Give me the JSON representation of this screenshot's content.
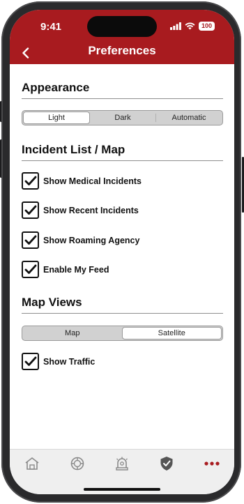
{
  "status": {
    "time": "9:41",
    "battery": "100"
  },
  "header": {
    "title": "Preferences"
  },
  "appearance": {
    "title": "Appearance",
    "options": [
      "Light",
      "Dark",
      "Automatic"
    ],
    "selected": "Light"
  },
  "incident": {
    "title": "Incident List / Map",
    "items": [
      {
        "label": "Show Medical Incidents",
        "checked": true
      },
      {
        "label": "Show Recent Incidents",
        "checked": true
      },
      {
        "label": "Show Roaming Agency",
        "checked": true
      },
      {
        "label": "Enable My Feed",
        "checked": true
      }
    ]
  },
  "mapviews": {
    "title": "Map Views",
    "options": [
      "Map",
      "Satellite"
    ],
    "selected": "Satellite",
    "items": [
      {
        "label": "Show Traffic",
        "checked": true
      }
    ]
  },
  "tabs": [
    {
      "icon": "house-icon"
    },
    {
      "icon": "fire-badge-icon"
    },
    {
      "icon": "alarm-bell-icon"
    },
    {
      "icon": "shield-check-icon"
    },
    {
      "icon": "more-dots-icon"
    }
  ],
  "colors": {
    "brand": "#a81b1f"
  }
}
